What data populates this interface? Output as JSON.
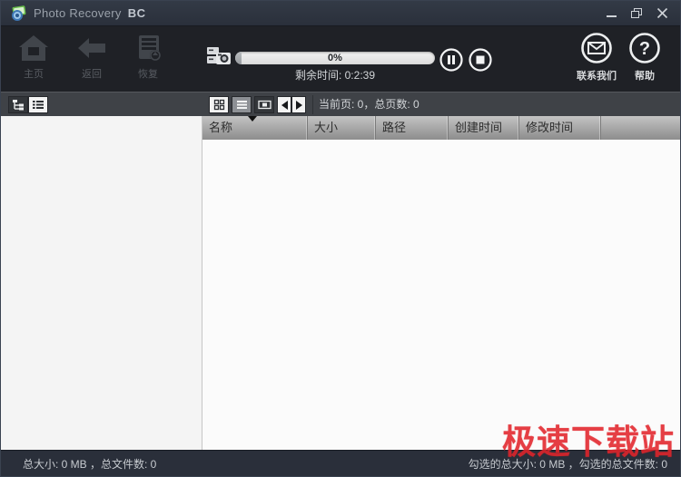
{
  "window": {
    "title": "Photo Recovery",
    "title_suffix": "BC"
  },
  "toolbar": {
    "buttons": [
      {
        "label": "主页",
        "icon": "home-icon"
      },
      {
        "label": "返回",
        "icon": "back-icon"
      },
      {
        "label": "恢复",
        "icon": "recover-icon"
      }
    ],
    "progress": {
      "percent_label": "0%",
      "fill_percent": 3,
      "remaining_label": "剩余时间: 0:2:39"
    },
    "contact_label": "联系我们",
    "help_label": "帮助",
    "help_glyph": "?"
  },
  "viewbar": {
    "page_status": "当前页: 0，总页数: 0"
  },
  "table": {
    "columns": [
      "名称",
      "大小",
      "路径",
      "创建时间",
      "修改时间"
    ]
  },
  "statusbar": {
    "left": "总大小: 0 MB ，总文件数: 0",
    "right": "勾选的总大小: 0 MB ，勾选的总文件数: 0"
  },
  "watermark": "极速下载站",
  "colors": {
    "titlebar_bg": "#2d333e",
    "toolbar_bg": "#1f2126",
    "viewbar_bg": "#3f4247",
    "header_gradient_top": "#c3c3c3",
    "header_gradient_bottom": "#8d8d8d",
    "statusbar_bg": "#2a2f3a",
    "watermark_red": "#e2242b",
    "disabled_icon": "#41454b"
  }
}
